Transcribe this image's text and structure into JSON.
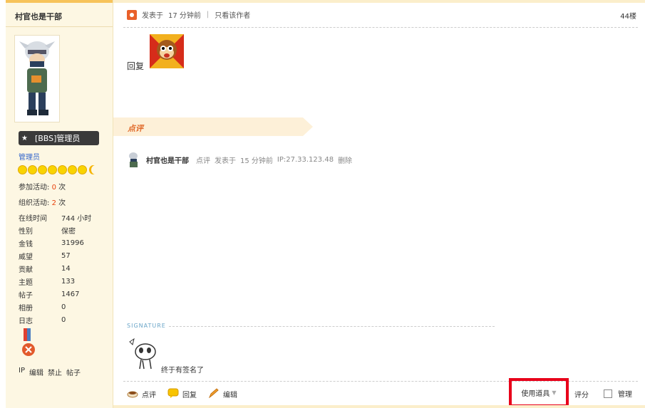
{
  "user": {
    "name": "村官也是干部",
    "group": "[BBS]管理员",
    "role": "管理员",
    "activities": [
      {
        "label": "参加活动:",
        "count": "0",
        "unit": "次"
      },
      {
        "label": "组织活动:",
        "count": "2",
        "unit": "次"
      }
    ],
    "stats": [
      {
        "key": "在线时间",
        "value": "744 小时"
      },
      {
        "key": "性别",
        "value": "保密"
      },
      {
        "key": "金钱",
        "value": "31996"
      },
      {
        "key": "威望",
        "value": "57"
      },
      {
        "key": "贡献",
        "value": "14"
      },
      {
        "key": "主题",
        "value": "133"
      },
      {
        "key": "帖子",
        "value": "1467"
      },
      {
        "key": "相册",
        "value": "0"
      },
      {
        "key": "日志",
        "value": "0"
      }
    ],
    "actions": [
      "IP",
      "编辑",
      "禁止",
      "帖子"
    ]
  },
  "post": {
    "posted_label": "发表于",
    "posted_time": "17 分钟前",
    "only_author": "只看该作者",
    "floor": "44楼",
    "content": "回复"
  },
  "comments": {
    "title": "点评",
    "items": [
      {
        "user": "村官也是干部",
        "action": "点评",
        "posted_label": "发表于",
        "time": "15 分钟前",
        "ip": "IP:27.33.123.48",
        "delete": "删除"
      }
    ]
  },
  "signature": {
    "label": "SIGNATURE",
    "text": "终于有签名了"
  },
  "footer": {
    "comment": "点评",
    "reply": "回复",
    "edit": "编辑",
    "tools": "使用道具",
    "rate": "评分",
    "manage": "管理"
  },
  "colors": {
    "accent_orange": "#e9602a",
    "highlight_red": "#e8001a",
    "panel_bg": "#fdf7e3"
  }
}
